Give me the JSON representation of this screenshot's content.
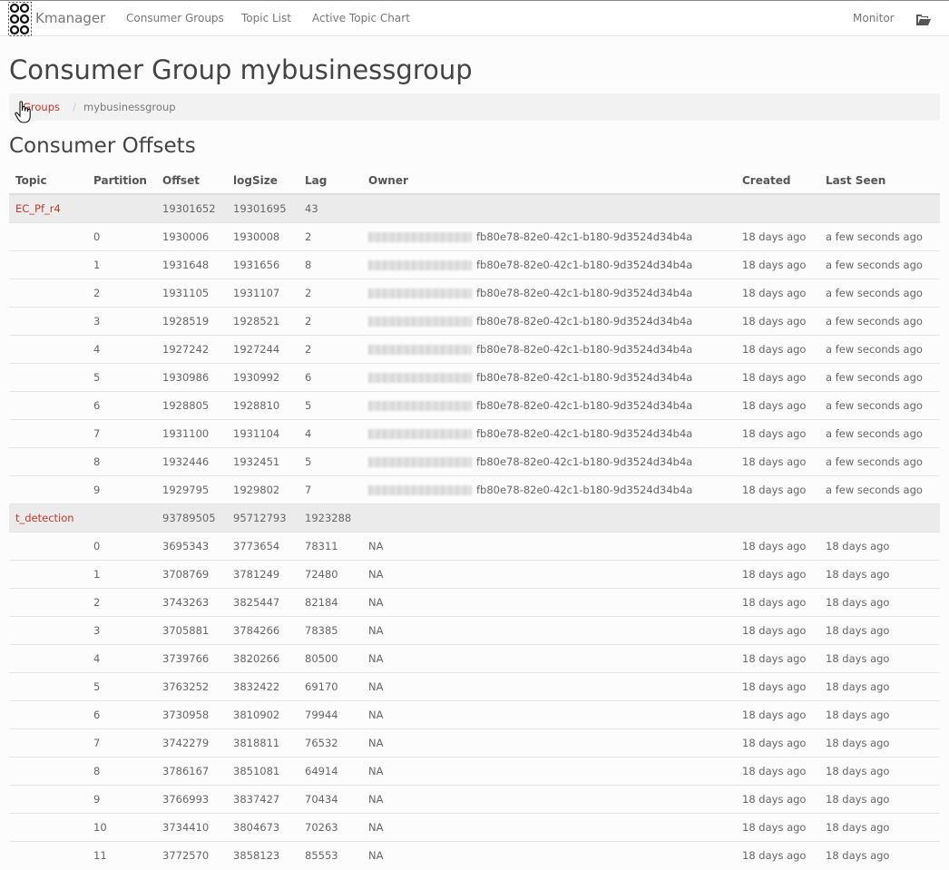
{
  "nav": {
    "brand": "Kmanager",
    "links": [
      "Consumer Groups",
      "Topic List",
      "Active Topic Chart"
    ],
    "monitor": "Monitor"
  },
  "page_title": "Consumer Group mybusinessgroup",
  "breadcrumb": {
    "link": "Groups",
    "separator": "/",
    "current": "mybusinessgroup"
  },
  "section_title": "Consumer Offsets",
  "table": {
    "headers": [
      "Topic",
      "Partition",
      "Offset",
      "logSize",
      "Lag",
      "Owner",
      "Created",
      "Last Seen"
    ],
    "groups": [
      {
        "topic": "EC_Pf_r4",
        "offset": "19301652",
        "logSize": "19301695",
        "lag": "43",
        "rows": [
          {
            "partition": "0",
            "offset": "1930006",
            "logSize": "1930008",
            "lag": "2",
            "owner": "fb80e78-82e0-42c1-b180-9d3524d34b4a",
            "created": "18 days ago",
            "last_seen": "a few seconds ago"
          },
          {
            "partition": "1",
            "offset": "1931648",
            "logSize": "1931656",
            "lag": "8",
            "owner": "fb80e78-82e0-42c1-b180-9d3524d34b4a",
            "created": "18 days ago",
            "last_seen": "a few seconds ago"
          },
          {
            "partition": "2",
            "offset": "1931105",
            "logSize": "1931107",
            "lag": "2",
            "owner": "fb80e78-82e0-42c1-b180-9d3524d34b4a",
            "created": "18 days ago",
            "last_seen": "a few seconds ago"
          },
          {
            "partition": "3",
            "offset": "1928519",
            "logSize": "1928521",
            "lag": "2",
            "owner": "fb80e78-82e0-42c1-b180-9d3524d34b4a",
            "created": "18 days ago",
            "last_seen": "a few seconds ago"
          },
          {
            "partition": "4",
            "offset": "1927242",
            "logSize": "1927244",
            "lag": "2",
            "owner": "fb80e78-82e0-42c1-b180-9d3524d34b4a",
            "created": "18 days ago",
            "last_seen": "a few seconds ago"
          },
          {
            "partition": "5",
            "offset": "1930986",
            "logSize": "1930992",
            "lag": "6",
            "owner": "fb80e78-82e0-42c1-b180-9d3524d34b4a",
            "created": "18 days ago",
            "last_seen": "a few seconds ago"
          },
          {
            "partition": "6",
            "offset": "1928805",
            "logSize": "1928810",
            "lag": "5",
            "owner": "fb80e78-82e0-42c1-b180-9d3524d34b4a",
            "created": "18 days ago",
            "last_seen": "a few seconds ago"
          },
          {
            "partition": "7",
            "offset": "1931100",
            "logSize": "1931104",
            "lag": "4",
            "owner": "fb80e78-82e0-42c1-b180-9d3524d34b4a",
            "created": "18 days ago",
            "last_seen": "a few seconds ago"
          },
          {
            "partition": "8",
            "offset": "1932446",
            "logSize": "1932451",
            "lag": "5",
            "owner": "fb80e78-82e0-42c1-b180-9d3524d34b4a",
            "created": "18 days ago",
            "last_seen": "a few seconds ago"
          },
          {
            "partition": "9",
            "offset": "1929795",
            "logSize": "1929802",
            "lag": "7",
            "owner": "fb80e78-82e0-42c1-b180-9d3524d34b4a",
            "created": "18 days ago",
            "last_seen": "a few seconds ago"
          }
        ]
      },
      {
        "topic": "t_detection",
        "offset": "93789505",
        "logSize": "95712793",
        "lag": "1923288",
        "rows": [
          {
            "partition": "0",
            "offset": "3695343",
            "logSize": "3773654",
            "lag": "78311",
            "owner": "NA",
            "created": "18 days ago",
            "last_seen": "18 days ago"
          },
          {
            "partition": "1",
            "offset": "3708769",
            "logSize": "3781249",
            "lag": "72480",
            "owner": "NA",
            "created": "18 days ago",
            "last_seen": "18 days ago"
          },
          {
            "partition": "2",
            "offset": "3743263",
            "logSize": "3825447",
            "lag": "82184",
            "owner": "NA",
            "created": "18 days ago",
            "last_seen": "18 days ago"
          },
          {
            "partition": "3",
            "offset": "3705881",
            "logSize": "3784266",
            "lag": "78385",
            "owner": "NA",
            "created": "18 days ago",
            "last_seen": "18 days ago"
          },
          {
            "partition": "4",
            "offset": "3739766",
            "logSize": "3820266",
            "lag": "80500",
            "owner": "NA",
            "created": "18 days ago",
            "last_seen": "18 days ago"
          },
          {
            "partition": "5",
            "offset": "3763252",
            "logSize": "3832422",
            "lag": "69170",
            "owner": "NA",
            "created": "18 days ago",
            "last_seen": "18 days ago"
          },
          {
            "partition": "6",
            "offset": "3730958",
            "logSize": "3810902",
            "lag": "79944",
            "owner": "NA",
            "created": "18 days ago",
            "last_seen": "18 days ago"
          },
          {
            "partition": "7",
            "offset": "3742279",
            "logSize": "3818811",
            "lag": "76532",
            "owner": "NA",
            "created": "18 days ago",
            "last_seen": "18 days ago"
          },
          {
            "partition": "8",
            "offset": "3786167",
            "logSize": "3851081",
            "lag": "64914",
            "owner": "NA",
            "created": "18 days ago",
            "last_seen": "18 days ago"
          },
          {
            "partition": "9",
            "offset": "3766993",
            "logSize": "3837427",
            "lag": "70434",
            "owner": "NA",
            "created": "18 days ago",
            "last_seen": "18 days ago"
          },
          {
            "partition": "10",
            "offset": "3734410",
            "logSize": "3804673",
            "lag": "70263",
            "owner": "NA",
            "created": "18 days ago",
            "last_seen": "18 days ago"
          },
          {
            "partition": "11",
            "offset": "3772570",
            "logSize": "3858123",
            "lag": "85553",
            "owner": "NA",
            "created": "18 days ago",
            "last_seen": "18 days ago"
          }
        ]
      }
    ]
  },
  "colors": {
    "link": "#c0392b",
    "topic_row_bg": "#ebebeb",
    "breadcrumb_bg": "#f2f2f2"
  },
  "icons": {
    "brand": "kafka-logo-icon",
    "monitor_menu": "folder-open-icon",
    "pointer": "hand-cursor-icon"
  }
}
